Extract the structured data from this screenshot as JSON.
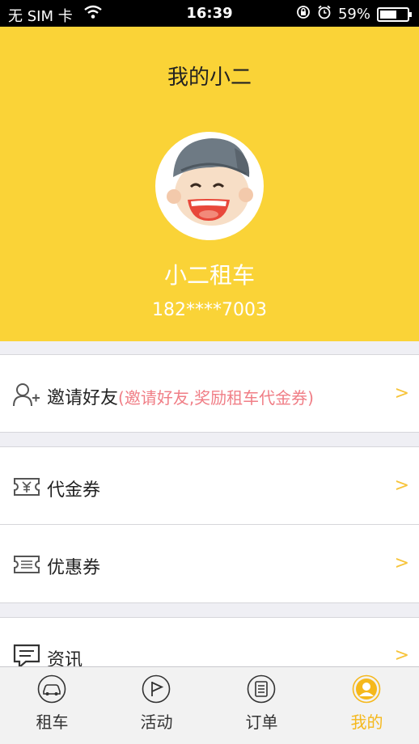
{
  "status_bar": {
    "carrier": "无 SIM 卡",
    "time": "16:39",
    "battery": "59%",
    "battery_level": 0.59
  },
  "header": {
    "title": "我的小二",
    "name": "小二租车",
    "phone": "182****7003"
  },
  "menu": {
    "invite": {
      "label": "邀请好友",
      "hint": "(邀请好友,奖励租车代金券)",
      "icon": "add-user-icon"
    },
    "voucher": {
      "label": "代金券",
      "icon": "voucher-icon"
    },
    "coupon": {
      "label": "优惠券",
      "icon": "coupon-icon"
    },
    "news": {
      "label": "资讯",
      "icon": "message-icon"
    },
    "chevron": ">"
  },
  "tabs": [
    {
      "label": "租车",
      "icon": "car-icon"
    },
    {
      "label": "活动",
      "icon": "flag-icon"
    },
    {
      "label": "订单",
      "icon": "order-icon"
    },
    {
      "label": "我的",
      "icon": "profile-icon",
      "active": true
    }
  ],
  "colors": {
    "accent": "#fad337",
    "active_tab": "#f5b81c",
    "hint": "#f07e86"
  }
}
